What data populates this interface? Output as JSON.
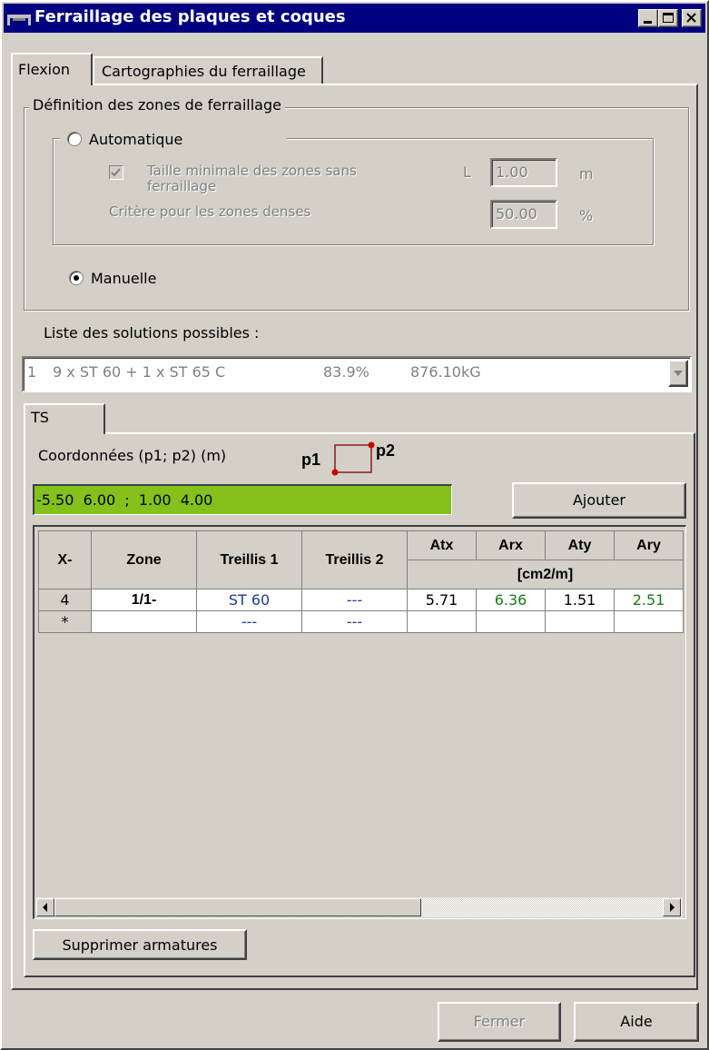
{
  "window": {
    "title": "Ferraillage des plaques et coques"
  },
  "tabs": [
    {
      "label": "Flexion",
      "active": true
    },
    {
      "label": "Cartographies du ferraillage",
      "active": false
    }
  ],
  "zones": {
    "group_label": "Définition des zones de ferraillage",
    "auto_label": "Automatique",
    "auto_selected": false,
    "min_size_label": "Taille minimale des zones sans ferraillage",
    "min_size_checked": true,
    "L_label": "L",
    "L_value": "1.00",
    "L_unit": "m",
    "dense_label": "Critère pour les zones denses",
    "dense_value": "50.00",
    "dense_unit": "%",
    "manual_label": "Manuelle",
    "manual_selected": true
  },
  "solutions": {
    "label": "Liste des solutions possibles :",
    "selected": {
      "index": "1",
      "desc": "9 x ST 60 + 1 x ST 65 C",
      "pct": "83.9%",
      "weight": "876.10kG"
    }
  },
  "ts_tab": {
    "label": "TS"
  },
  "coords": {
    "label": "Coordonnées (p1; p2) (m)",
    "p1": "p1",
    "p2": "p2",
    "value": "-5.50  6.00  ;  1.00  4.00",
    "add_button": "Ajouter"
  },
  "grid": {
    "headers": {
      "x": "X-",
      "zone": "Zone",
      "treillis1": "Treillis 1",
      "treillis2": "Treillis 2",
      "atx": "Atx",
      "arx": "Arx",
      "aty": "Aty",
      "ary": "Ary",
      "unit": "[cm2/m]"
    },
    "rows": [
      {
        "x": "4",
        "zone": "1/1-",
        "treillis1": "ST 60",
        "treillis2": "---",
        "atx": "5.71",
        "arx": "6.36",
        "aty": "1.51",
        "ary": "2.51"
      },
      {
        "x": "*",
        "zone": "",
        "treillis1": "---",
        "treillis2": "---",
        "atx": "",
        "arx": "",
        "aty": "",
        "ary": ""
      }
    ]
  },
  "buttons": {
    "delete": "Supprimer armatures",
    "close": "Fermer",
    "help": "Aide"
  },
  "colors": {
    "title_bar": "#000080",
    "coord_field": "#84c11a",
    "marker_red": "#cc0000"
  }
}
